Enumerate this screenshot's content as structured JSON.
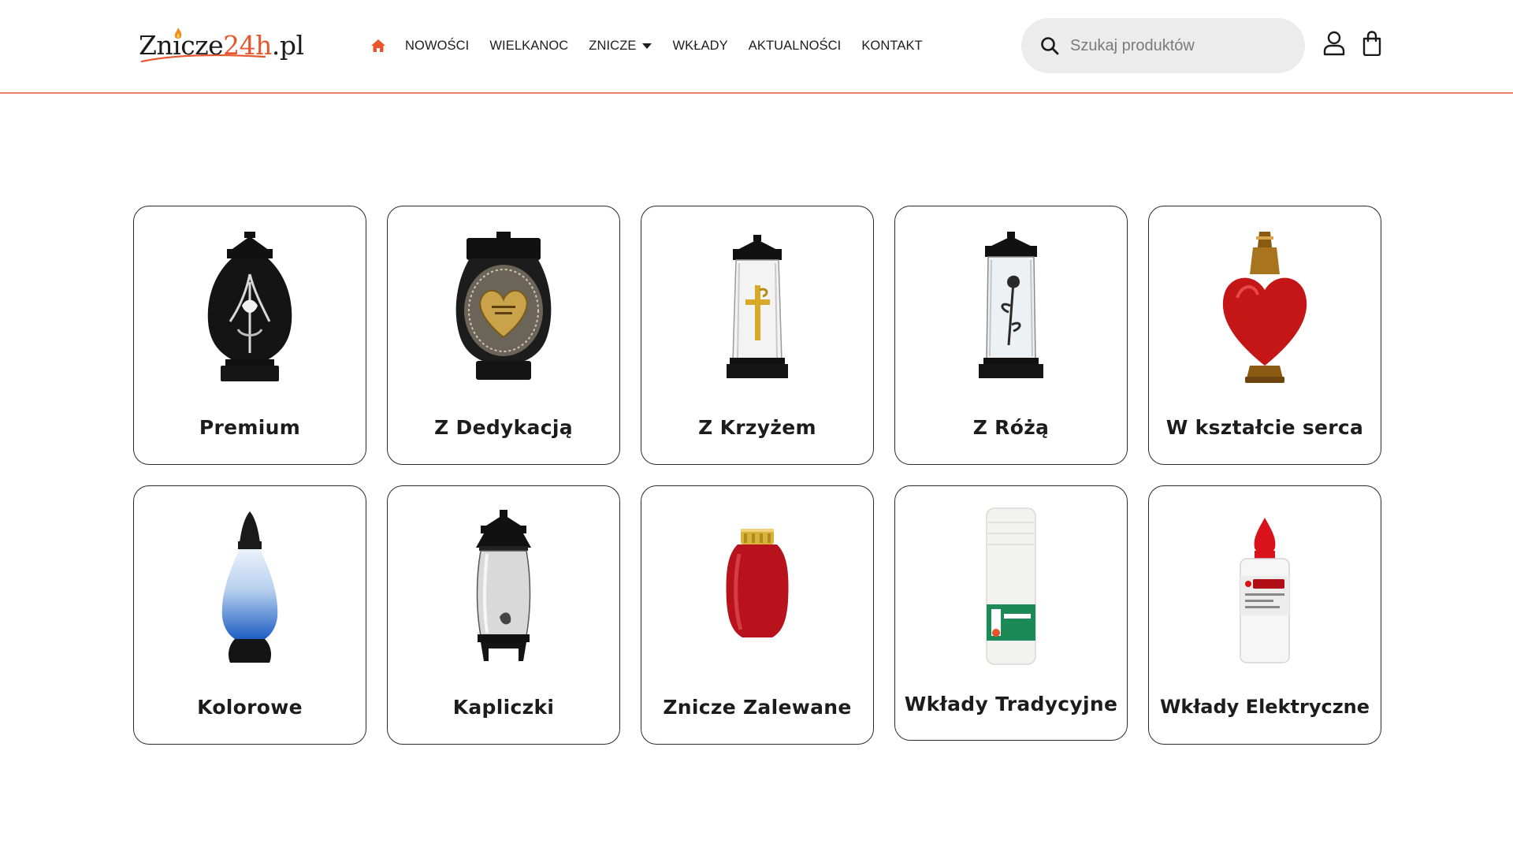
{
  "header": {
    "logo": {
      "main": "Znicze",
      "accent": "24h",
      "suffix": ".pl"
    },
    "nav": [
      {
        "label": "NOWOŚCI"
      },
      {
        "label": "WIELKANOC"
      },
      {
        "label": "ZNICZE",
        "has_dropdown": true
      },
      {
        "label": "WKŁADY"
      },
      {
        "label": "AKTUALNOŚCI"
      },
      {
        "label": "KONTAKT"
      }
    ],
    "home_icon": "home-icon",
    "search": {
      "placeholder": "Szukaj produktów",
      "icon": "search-icon"
    },
    "account_icon": "user-icon",
    "cart_icon": "shopping-bag-icon"
  },
  "categories": [
    {
      "label": "Premium",
      "image": "black-lantern-with-lily"
    },
    {
      "label": "Z Dedykacją",
      "image": "gold-heart-dedication-lantern"
    },
    {
      "label": "Z Krzyżem",
      "image": "glass-lantern-with-gold-cross"
    },
    {
      "label": "Z Różą",
      "image": "glass-lantern-with-rose"
    },
    {
      "label": "W kształcie serca",
      "image": "red-heart-candle"
    },
    {
      "label": "Kolorowe",
      "image": "blue-gradient-candle"
    },
    {
      "label": "Kapliczki",
      "image": "chapel-lantern"
    },
    {
      "label": "Znicze Zalewane",
      "image": "red-poured-candle"
    },
    {
      "label": "Wkłady Tradycyjne",
      "image": "white-traditional-insert"
    },
    {
      "label": "Wkłady Elektryczne",
      "image": "electric-insert-red-flame"
    }
  ],
  "colors": {
    "accent": "#e8542c",
    "divider": "#e8806b",
    "search_bg": "#ececec"
  }
}
